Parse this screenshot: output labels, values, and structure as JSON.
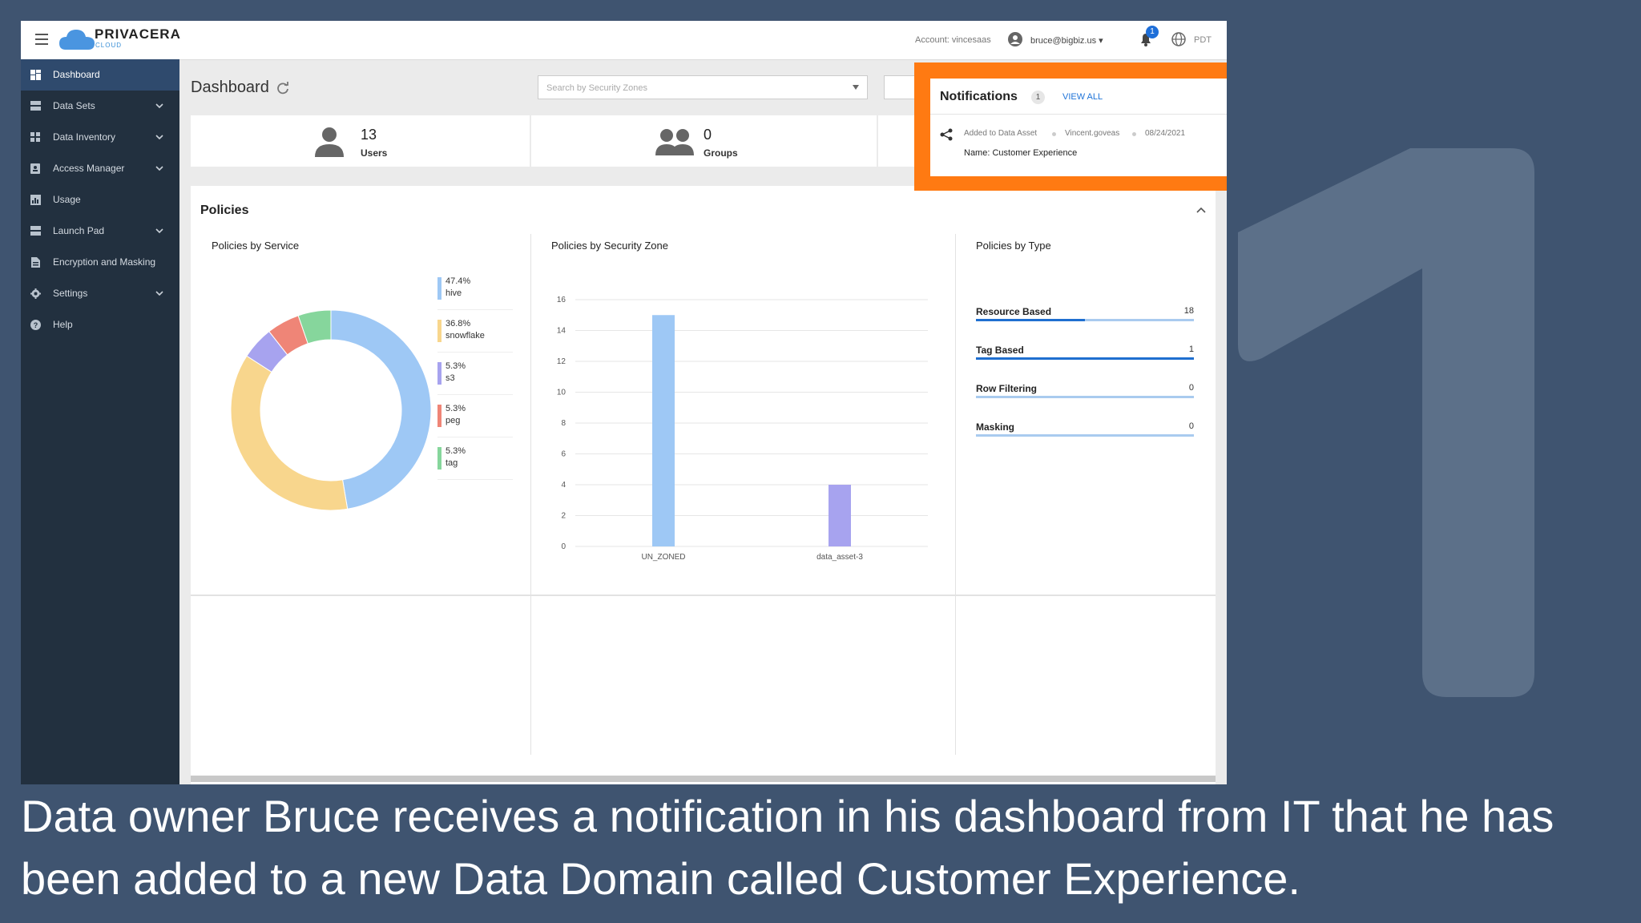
{
  "background_number": "1",
  "caption": "Data owner Bruce receives a notification in his dashboard from IT that he has been added to a new Data Domain called Customer Experience.",
  "brand": {
    "name": "PRIVACERA",
    "sub": "CLOUD"
  },
  "header": {
    "account": "Account: vincesaas",
    "user": "bruce@bigbiz.us",
    "bell_count": "1",
    "timezone": "PDT"
  },
  "sidebar": {
    "items": [
      {
        "label": "Dashboard",
        "icon": "dashboard-icon",
        "expandable": false,
        "active": true
      },
      {
        "label": "Data Sets",
        "icon": "datasets-icon",
        "expandable": true
      },
      {
        "label": "Data Inventory",
        "icon": "inventory-icon",
        "expandable": true
      },
      {
        "label": "Access Manager",
        "icon": "access-icon",
        "expandable": true
      },
      {
        "label": "Usage",
        "icon": "usage-icon",
        "expandable": false
      },
      {
        "label": "Launch Pad",
        "icon": "launchpad-icon",
        "expandable": true
      },
      {
        "label": "Encryption and Masking",
        "icon": "encryption-icon",
        "expandable": false
      },
      {
        "label": "Settings",
        "icon": "gear-icon",
        "expandable": true
      },
      {
        "label": "Help",
        "icon": "help-icon",
        "expandable": false
      }
    ]
  },
  "page": {
    "title": "Dashboard",
    "search_placeholder": "Search by Security Zones"
  },
  "stats": {
    "users": {
      "value": "13",
      "label": "Users"
    },
    "groups": {
      "value": "0",
      "label": "Groups"
    }
  },
  "policies": {
    "title": "Policies",
    "by_service_title": "Policies by Service",
    "by_zone_title": "Policies by Security Zone",
    "by_type_title": "Policies by Type",
    "service_legend": [
      {
        "pct": "47.4%",
        "name": "hive",
        "color": "#9ec8f5"
      },
      {
        "pct": "36.8%",
        "name": "snowflake",
        "color": "#f8d68d"
      },
      {
        "pct": "5.3%",
        "name": "s3",
        "color": "#a7a3ef"
      },
      {
        "pct": "5.3%",
        "name": "peg",
        "color": "#ef8577"
      },
      {
        "pct": "5.3%",
        "name": "tag",
        "color": "#86d69c"
      }
    ],
    "types": [
      {
        "name": "Resource Based",
        "value": "18",
        "fraction": 0.5
      },
      {
        "name": "Tag Based",
        "value": "1",
        "fraction": 1.0
      },
      {
        "name": "Row Filtering",
        "value": "0",
        "fraction": 0
      },
      {
        "name": "Masking",
        "value": "0",
        "fraction": 0
      }
    ]
  },
  "notifications": {
    "title": "Notifications",
    "count": "1",
    "view_all": "VIEW ALL",
    "item": {
      "action": "Added to Data Asset",
      "by": "Vincent.goveas",
      "date": "08/24/2021",
      "name": "Name: Customer Experience"
    },
    "highlight_color": "#ff7a12"
  },
  "chart_data": [
    {
      "type": "pie",
      "title": "Policies by Service",
      "categories": [
        "hive",
        "snowflake",
        "s3",
        "peg",
        "tag"
      ],
      "values": [
        47.4,
        36.8,
        5.3,
        5.3,
        5.3
      ],
      "colors": [
        "#9ec8f5",
        "#f8d68d",
        "#a7a3ef",
        "#ef8577",
        "#86d69c"
      ],
      "legend": "right"
    },
    {
      "type": "bar",
      "title": "Policies by Security Zone",
      "categories": [
        "UN_ZONED",
        "data_asset-3"
      ],
      "values": [
        15,
        4
      ],
      "colors": [
        "#9ec8f5",
        "#a7a3ef"
      ],
      "ylim": [
        0,
        16
      ],
      "yticks": [
        0,
        2,
        4,
        6,
        8,
        10,
        12,
        14,
        16
      ],
      "grid": true
    }
  ]
}
